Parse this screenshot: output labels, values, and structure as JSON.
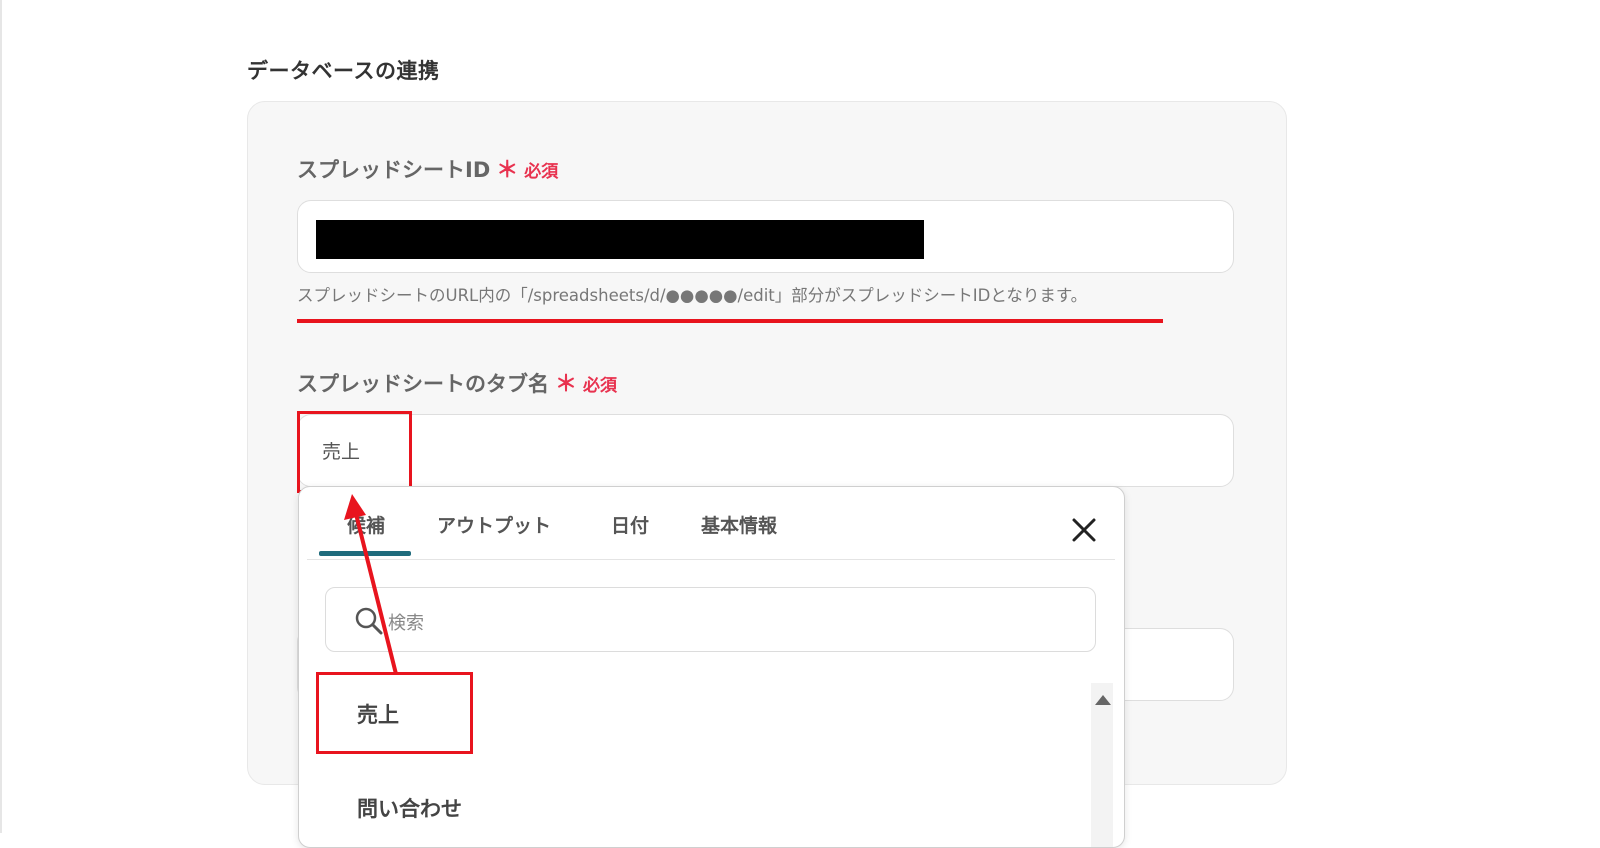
{
  "section": {
    "title": "データベースの連携"
  },
  "spreadsheet_id": {
    "label": "スプレッドシートID",
    "required_mark": "＊",
    "required_text": "必須",
    "help": "スプレッドシートのURL内の「/spreadsheets/d/●●●●●/edit」部分がスプレッドシートIDとなります。"
  },
  "tab_name": {
    "label": "スプレッドシートのタブ名",
    "required_mark": "＊",
    "required_text": "必須",
    "value": "売上"
  },
  "dropdown": {
    "tabs": [
      {
        "label": "候補"
      },
      {
        "label": "アウトプット"
      },
      {
        "label": "日付"
      },
      {
        "label": "基本情報"
      }
    ],
    "search_placeholder": "検索",
    "options": [
      {
        "label": "売上"
      },
      {
        "label": "問い合わせ"
      }
    ]
  },
  "colors": {
    "accent_red": "#e8141e",
    "required_red": "#e8324f",
    "tab_indicator": "#1f6b7c"
  }
}
